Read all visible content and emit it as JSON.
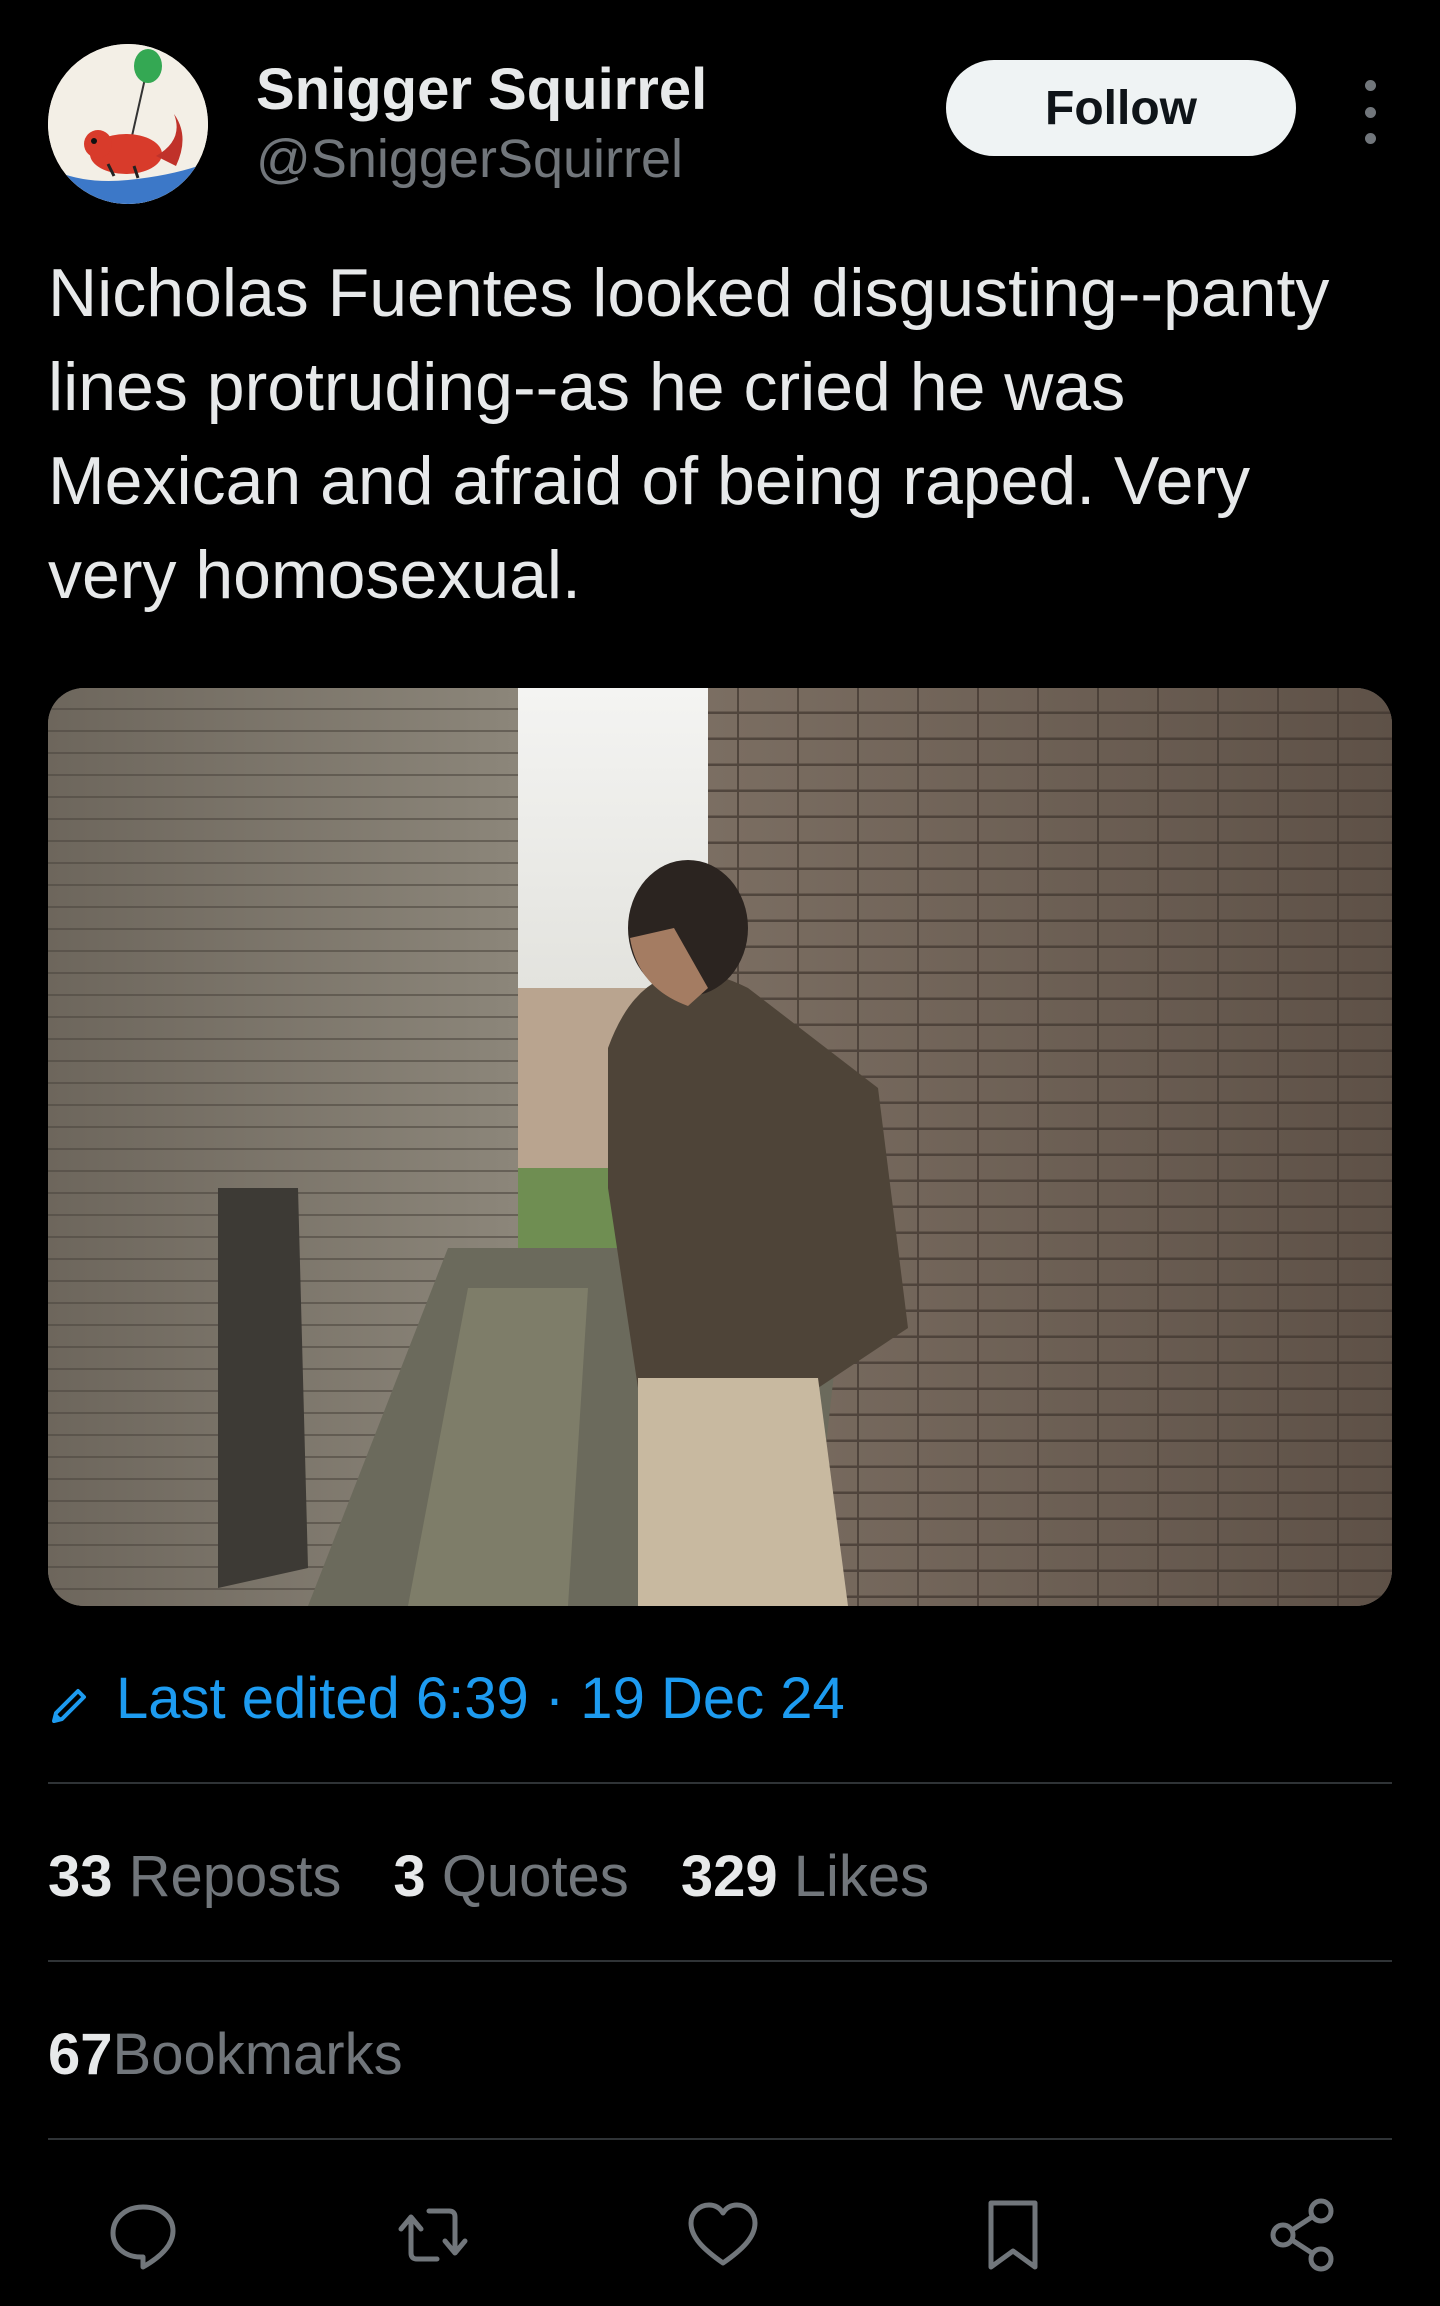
{
  "author": {
    "display_name": "Snigger Squirrel",
    "handle": "@SniggerSquirrel",
    "avatar_icon": "squirrel-cartoon-avatar"
  },
  "header": {
    "follow_label": "Follow",
    "more_icon": "more-vertical-icon"
  },
  "tweet": {
    "text": "Nicholas Fuentes looked disgusting--panty lines protruding--as he cried he was Mexican and afraid of being raped. Very very homosexual.",
    "media_description_icon": "video-thumbnail-alley"
  },
  "edit": {
    "label": "Last edited 6:39 · 19 Dec 24",
    "icon": "pencil-icon"
  },
  "stats": {
    "reposts_count": "33",
    "reposts_label": "Reposts",
    "quotes_count": "3",
    "quotes_label": "Quotes",
    "likes_count": "329",
    "likes_label": "Likes",
    "bookmarks_count": "67",
    "bookmarks_label": "Bookmarks"
  },
  "actions": [
    {
      "icon": "reply-icon"
    },
    {
      "icon": "repost-icon"
    },
    {
      "icon": "like-icon"
    },
    {
      "icon": "bookmark-icon"
    },
    {
      "icon": "share-icon"
    }
  ],
  "colors": {
    "background": "#000000",
    "text_primary": "#e7e9ea",
    "text_secondary": "#71767b",
    "accent": "#1d9bf0",
    "divider": "#2f3336",
    "follow_button_bg": "#eff3f4"
  }
}
